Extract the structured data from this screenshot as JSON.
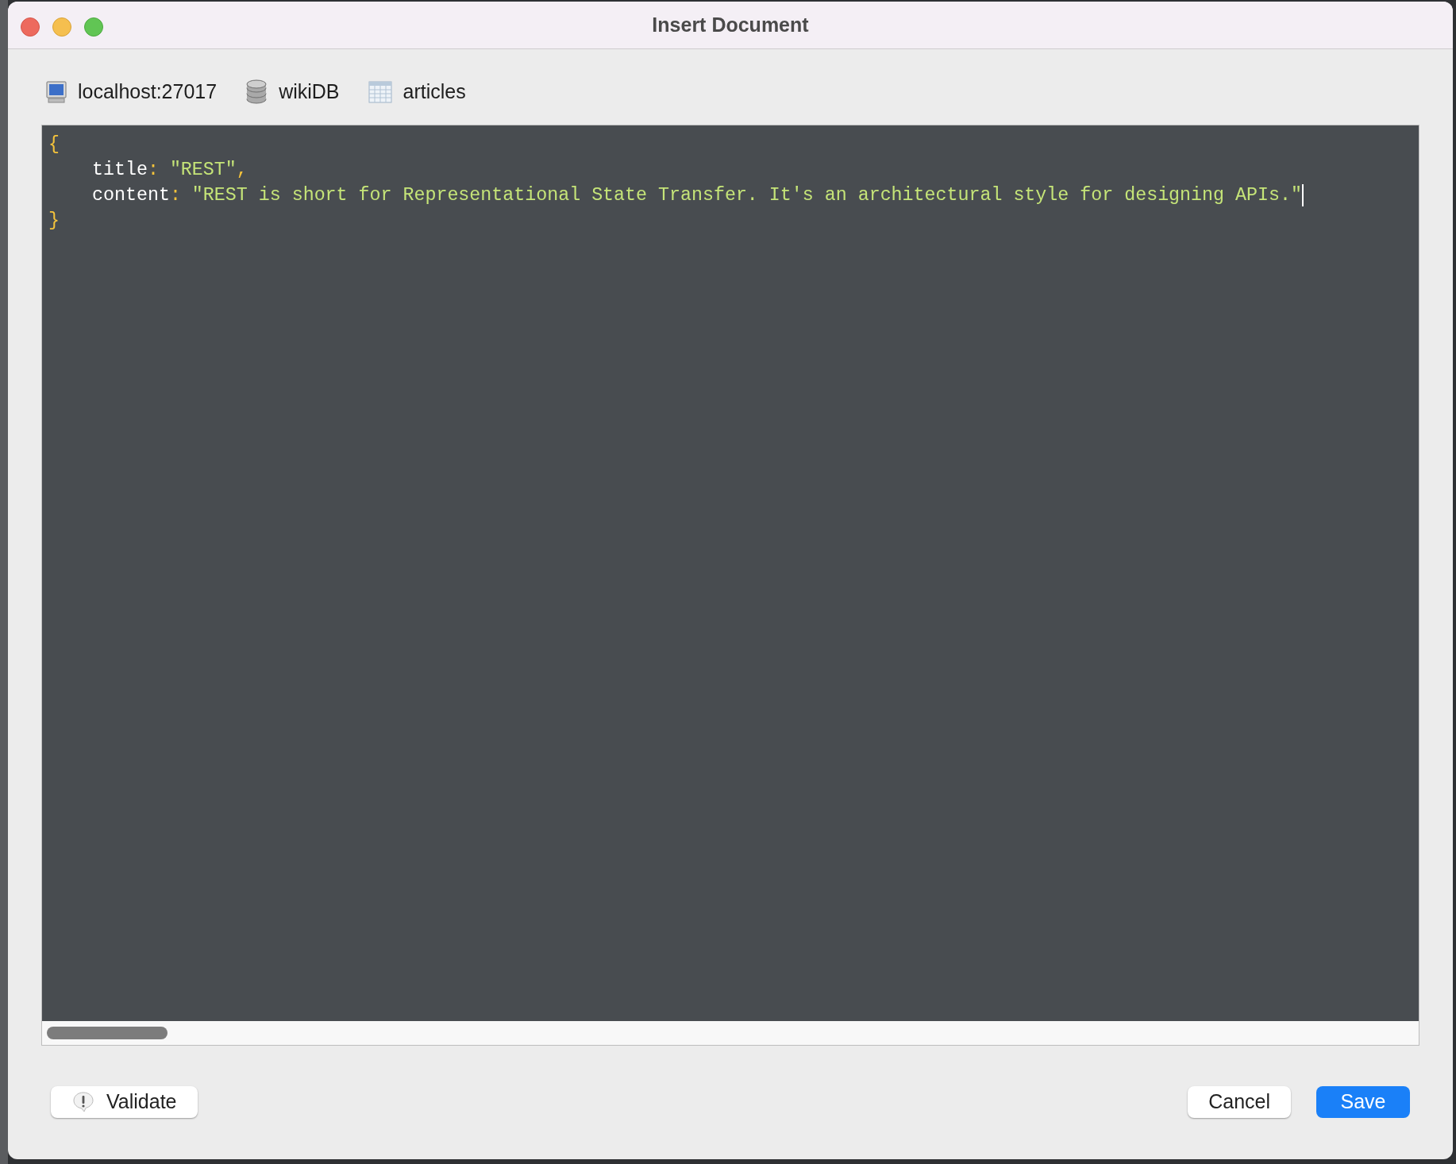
{
  "window": {
    "title": "Insert Document"
  },
  "breadcrumb": [
    {
      "kind": "server",
      "label": "localhost:27017"
    },
    {
      "kind": "database",
      "label": "wikiDB"
    },
    {
      "kind": "collection",
      "label": "articles"
    }
  ],
  "editor": {
    "open_brace": "{",
    "fields": [
      {
        "key": "title",
        "colon": ":",
        "value": "\"REST\"",
        "comma": ",",
        "cursor": false
      },
      {
        "key": "content",
        "colon": ":",
        "value": "\"REST is short for Representational State Transfer. It's an architectural style for designing APIs.\"",
        "cursor": true
      }
    ],
    "close_brace": "}"
  },
  "buttons": [
    {
      "kind": "validate",
      "label": "Validate"
    },
    {
      "kind": "cancel",
      "label": "Cancel"
    },
    {
      "kind": "save",
      "label": "Save"
    }
  ]
}
